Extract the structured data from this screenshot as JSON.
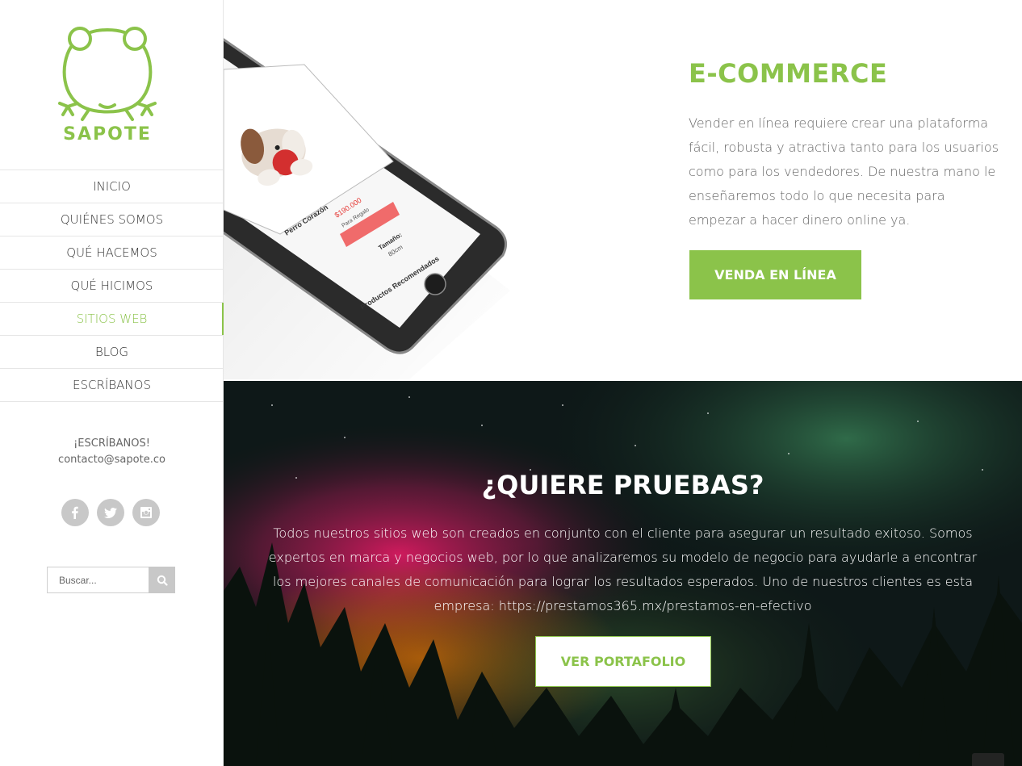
{
  "brand": {
    "name": "SAPOTE",
    "accent": "#8bc34a"
  },
  "nav": {
    "items": [
      {
        "label": "INICIO"
      },
      {
        "label": "QUIÉNES SOMOS"
      },
      {
        "label": "QUÉ HACEMOS"
      },
      {
        "label": "QUÉ HICIMOS"
      },
      {
        "label": "SITIOS WEB",
        "active": true
      },
      {
        "label": "BLOG"
      },
      {
        "label": "ESCRÍBANOS"
      }
    ]
  },
  "contact": {
    "heading": "¡ESCRÍBANOS!",
    "email": "contacto@sapote.co"
  },
  "social": {
    "icons": [
      "facebook-icon",
      "twitter-icon",
      "instagram-icon"
    ]
  },
  "search": {
    "placeholder": "Buscar..."
  },
  "phone_screen": {
    "product_name": "Perro Corazón",
    "price": "$190.000",
    "note": "Para Regalo",
    "size_label": "Tamaño:",
    "size_value": "80cm",
    "recommended": "Productos Recomendados"
  },
  "ecommerce": {
    "title": "E-COMMERCE",
    "text": "Vender en línea requiere crear una plataforma fácil, robusta y atractiva tanto para los usuarios como para los vendedores. De nuestra mano le enseñaremos todo lo que necesita para empezar a hacer dinero online ya.",
    "button": "VENDA EN LÍNEA"
  },
  "proof": {
    "title": "¿QUIERE PRUEBAS?",
    "text": "Todos nuestros sitios web son creados en conjunto con el cliente para asegurar un resultado exitoso. Somos expertos en marca y negocios web, por lo que analizaremos su modelo de negocio para ayudarle a encontrar los mejores canales de comunicación para lograr los resultados esperados. Uno de nuestros clientes es esta empresa: https://prestamos365.mx/prestamos-en-efectivo",
    "button": "VER PORTAFOLIO"
  }
}
